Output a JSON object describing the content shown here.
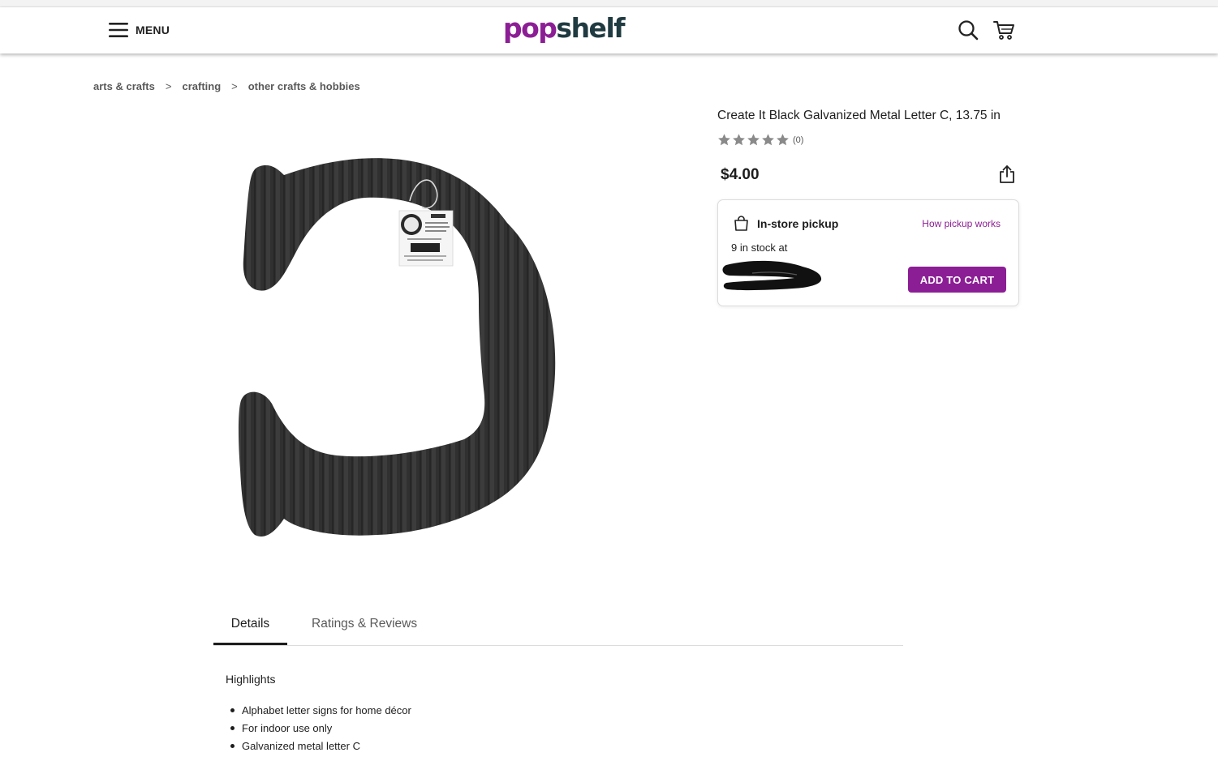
{
  "header": {
    "menu_label": "MENU",
    "logo_pop": "pop",
    "logo_shelf": "shelf"
  },
  "breadcrumb": [
    {
      "label": "arts & crafts"
    },
    {
      "label": "crafting"
    },
    {
      "label": "other crafts & hobbies"
    }
  ],
  "breadcrumb_separator": ">",
  "product": {
    "title": "Create It Black Galvanized Metal Letter C, 13.75 in",
    "rating": 0,
    "review_count": "(0)",
    "price": "$4.00",
    "image_icon": "metal-letter-c"
  },
  "pickup": {
    "label": "In-store pickup",
    "how_link": "How pickup works",
    "stock_text": "9 in stock at",
    "add_to_cart": "ADD TO CART"
  },
  "tabs": [
    {
      "label": "Details",
      "active": true
    },
    {
      "label": "Ratings & Reviews",
      "active": false
    }
  ],
  "highlights": {
    "title": "Highlights",
    "items": [
      "Alphabet letter signs for home décor",
      "For indoor use only",
      "Galvanized metal letter C"
    ]
  },
  "colors": {
    "brand": "#8c1e95",
    "logo_dark": "#1f3a40",
    "star_empty": "#8a8a8a"
  }
}
